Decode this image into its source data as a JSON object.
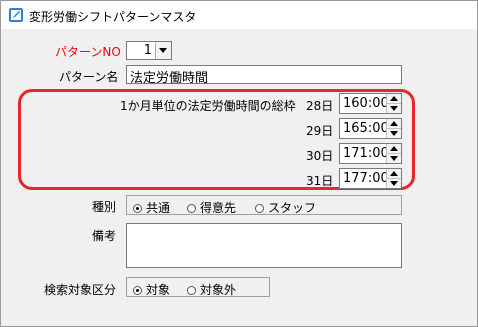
{
  "window": {
    "title": "変形労働シフトパターンマスタ",
    "icon": "app-edit-icon"
  },
  "pattern_no": {
    "label": "パターンNO",
    "value": "1",
    "label_color": "#ff0000"
  },
  "pattern_name": {
    "label": "パターン名",
    "value": "法定労働時間"
  },
  "legal_hours": {
    "label": "1か月単位の法定労働時間の総枠",
    "highlight_color": "#e8262b",
    "rows": [
      {
        "day_label": "28日",
        "value": "160:00"
      },
      {
        "day_label": "29日",
        "value": "165:00"
      },
      {
        "day_label": "30日",
        "value": "171:00"
      },
      {
        "day_label": "31日",
        "value": "177:00"
      }
    ]
  },
  "category": {
    "label": "種別",
    "options": [
      {
        "label": "共通",
        "selected": true
      },
      {
        "label": "得意先",
        "selected": false
      },
      {
        "label": "スタッフ",
        "selected": false
      }
    ]
  },
  "remarks": {
    "label": "備考",
    "value": ""
  },
  "search_target": {
    "label": "検索対象区分",
    "options": [
      {
        "label": "対象",
        "selected": true
      },
      {
        "label": "対象外",
        "selected": false
      }
    ]
  }
}
